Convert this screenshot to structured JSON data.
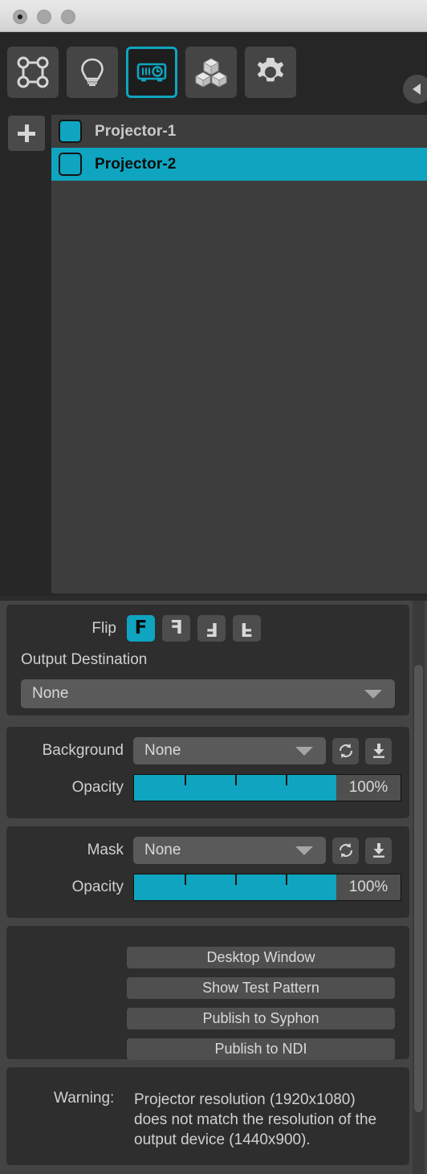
{
  "window": {
    "traffic_lights": [
      {
        "name": "close-button"
      },
      {
        "name": "minimize-button"
      },
      {
        "name": "zoom-button"
      }
    ]
  },
  "toolbar": {
    "items": [
      {
        "icon": "warp-mesh-icon",
        "label": "Warp",
        "active": false
      },
      {
        "icon": "light-bulb-icon",
        "label": "Lights",
        "active": false
      },
      {
        "icon": "projector-icon",
        "label": "Projectors",
        "active": true
      },
      {
        "icon": "cubes-icon",
        "label": "Objects",
        "active": false
      },
      {
        "icon": "gear-icon",
        "label": "Settings",
        "active": false
      }
    ],
    "collapse_icon": "chevron-left-icon"
  },
  "projector_list": {
    "add_button_label": "+",
    "rows": [
      {
        "label": "Projector-1",
        "checked": true,
        "selected": false
      },
      {
        "label": "Projector-2",
        "checked": true,
        "selected": true
      }
    ]
  },
  "flip": {
    "label": "Flip",
    "glyph": "F",
    "options": [
      {
        "name": "flip-none",
        "selected": true
      },
      {
        "name": "flip-horizontal",
        "selected": false
      },
      {
        "name": "flip-horizontal-vertical",
        "selected": false
      },
      {
        "name": "flip-vertical",
        "selected": false
      }
    ]
  },
  "output_destination": {
    "label": "Output Destination",
    "value": "None"
  },
  "background": {
    "label": "Background",
    "value": "None",
    "refresh_icon": "refresh-icon",
    "load_icon": "download-icon",
    "opacity_label": "Opacity",
    "opacity_value": "100%",
    "opacity_percent": 100
  },
  "mask": {
    "label": "Mask",
    "value": "None",
    "refresh_icon": "refresh-icon",
    "load_icon": "download-icon",
    "opacity_label": "Opacity",
    "opacity_value": "100%",
    "opacity_percent": 100
  },
  "actions": [
    {
      "label": "Desktop Window",
      "name": "desktop-window-button"
    },
    {
      "label": "Show Test Pattern",
      "name": "show-test-pattern-button"
    },
    {
      "label": "Publish to Syphon",
      "name": "publish-to-syphon-button"
    },
    {
      "label": "Publish to NDI",
      "name": "publish-to-ndi-button"
    }
  ],
  "warning": {
    "label": "Warning:",
    "text": "Projector resolution (1920x1080) does not match the resolution of the output device (1440x900)."
  },
  "colors": {
    "accent": "#0fa5c0",
    "panel": "#2e2e2e",
    "panel_bg": "#444444",
    "control": "#4f4f4f",
    "text": "#d0d0d0"
  }
}
